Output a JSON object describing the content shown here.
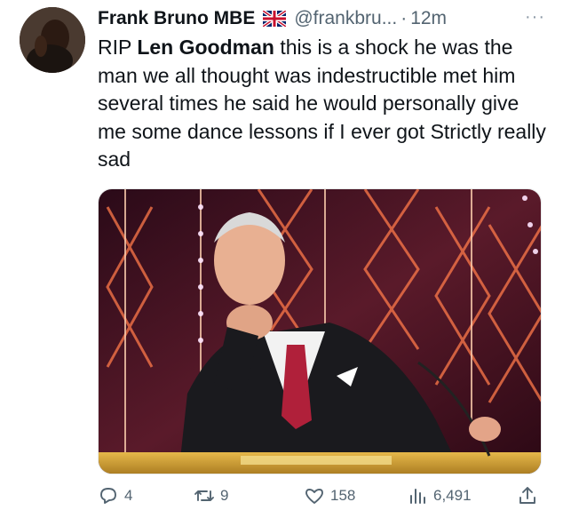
{
  "tweet": {
    "author_name": "Frank Bruno MBE",
    "handle": "@frankbru...",
    "separator": "·",
    "time": "12m",
    "more_label": "···",
    "text_part1": "RIP ",
    "text_bold": "Len Goodman",
    "text_part2": " this is a shock he was the man we all thought was indestructible met him several times  he said he would personally give me some dance lessons if I ever got Strictly really sad"
  },
  "actions": {
    "reply_count": "4",
    "retweet_count": "9",
    "like_count": "158",
    "view_count": "6,491"
  },
  "icons": {
    "flag": "uk-flag-icon",
    "reply": "reply-icon",
    "retweet": "retweet-icon",
    "like": "heart-icon",
    "views": "views-icon",
    "share": "share-icon"
  },
  "colors": {
    "text_primary": "#0f1419",
    "text_secondary": "#536471",
    "background": "#ffffff"
  }
}
